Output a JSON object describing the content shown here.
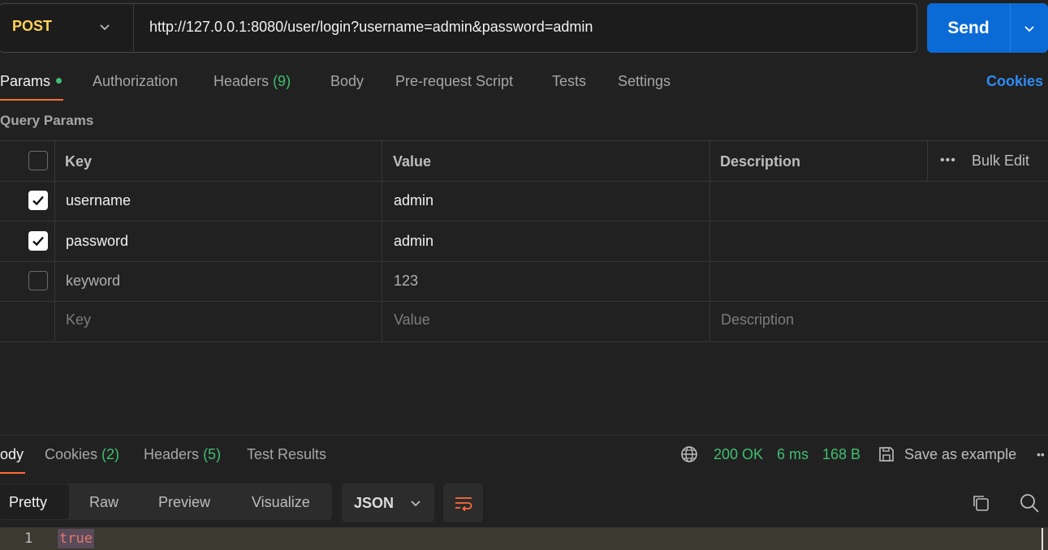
{
  "request": {
    "method": "POST",
    "url": "http://127.0.0.1:8080/user/login?username=admin&password=admin",
    "send_label": "Send"
  },
  "request_tabs": {
    "params": "Params",
    "authorization": "Authorization",
    "headers": "Headers",
    "headers_count": "(9)",
    "body": "Body",
    "prerequest": "Pre-request Script",
    "tests": "Tests",
    "settings": "Settings",
    "cookies": "Cookies"
  },
  "query_params": {
    "title": "Query Params",
    "headers": {
      "key": "Key",
      "value": "Value",
      "description": "Description",
      "bulk_edit": "Bulk Edit",
      "more": "•••"
    },
    "rows": [
      {
        "key": "username",
        "value": "admin",
        "checked": true
      },
      {
        "key": "password",
        "value": "admin",
        "checked": true
      },
      {
        "key": "keyword",
        "value": "123",
        "checked": false
      }
    ],
    "placeholder": {
      "key": "Key",
      "value": "Value",
      "description": "Description"
    }
  },
  "response": {
    "tabs": {
      "body": "ody",
      "cookies": "Cookies",
      "cookies_count": "(2)",
      "headers": "Headers",
      "headers_count": "(5)",
      "tests": "Test Results"
    },
    "status": "200 OK",
    "time": "6 ms",
    "size": "168 B",
    "save_example": "Save as example",
    "overflow": "••",
    "view_modes": [
      "Pretty",
      "Raw",
      "Preview",
      "Visualize"
    ],
    "format": "JSON",
    "line_number": "1",
    "body_value": "true"
  },
  "colors": {
    "accent": "#ff6c37",
    "send_button": "#0b6bd6",
    "success": "#3fbf6f",
    "method": "#ffd35a",
    "link": "#2f8cf5"
  }
}
